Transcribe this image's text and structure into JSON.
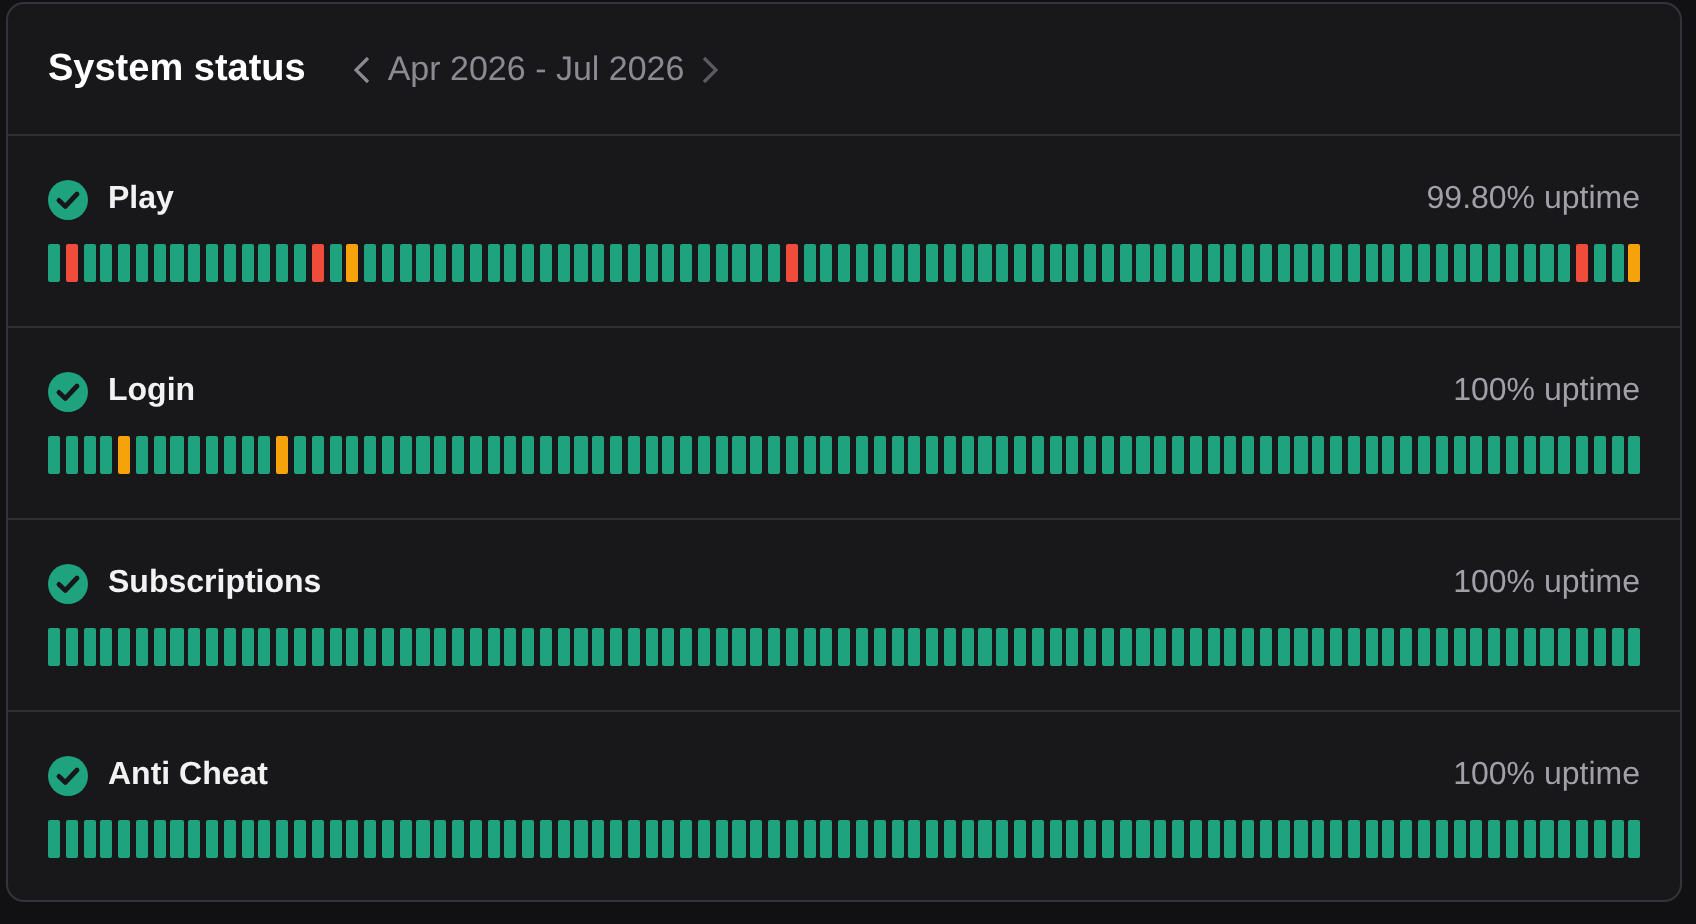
{
  "header": {
    "title": "System status",
    "date_range": "Apr 2026 - Jul 2026"
  },
  "services": [
    {
      "name": "Play",
      "uptime": "99.80% uptime",
      "bars": [
        {
          "color": "#1fa37f"
        },
        {
          "color": "#ef4c3c"
        },
        {
          "color": "#1fa37f"
        },
        {
          "color": "#1fa37f"
        },
        {
          "color": "#1fa37f"
        },
        {
          "color": "#1fa37f"
        },
        {
          "color": "#1fa37f"
        },
        {
          "color": "#1fa37f"
        },
        {
          "color": "#1fa37f"
        },
        {
          "color": "#1fa37f"
        },
        {
          "color": "#1fa37f"
        },
        {
          "color": "#1fa37f"
        },
        {
          "color": "#1fa37f"
        },
        {
          "color": "#1fa37f"
        },
        {
          "color": "#1fa37f"
        },
        {
          "color": "#ef4c3c"
        },
        {
          "color": "#1fa37f"
        },
        {
          "color": "#f5a20b"
        },
        {
          "color": "#1fa37f"
        },
        {
          "color": "#1fa37f"
        },
        {
          "color": "#1fa37f"
        },
        {
          "color": "#1fa37f"
        },
        {
          "color": "#1fa37f"
        },
        {
          "color": "#1fa37f"
        },
        {
          "color": "#1fa37f"
        },
        {
          "color": "#1fa37f"
        },
        {
          "color": "#1fa37f"
        },
        {
          "color": "#1fa37f"
        },
        {
          "color": "#1fa37f"
        },
        {
          "color": "#1fa37f"
        },
        {
          "color": "#1fa37f"
        },
        {
          "color": "#1fa37f"
        },
        {
          "color": "#1fa37f"
        },
        {
          "color": "#1fa37f"
        },
        {
          "color": "#1fa37f"
        },
        {
          "color": "#1fa37f"
        },
        {
          "color": "#1fa37f"
        },
        {
          "color": "#1fa37f"
        },
        {
          "color": "#1fa37f"
        },
        {
          "color": "#1fa37f"
        },
        {
          "color": "#1fa37f"
        },
        {
          "color": "#1fa37f"
        },
        {
          "color": "#ef4c3c"
        },
        {
          "color": "#1fa37f"
        },
        {
          "color": "#1fa37f"
        },
        {
          "color": "#1fa37f"
        },
        {
          "color": "#1fa37f"
        },
        {
          "color": "#1fa37f"
        },
        {
          "color": "#1fa37f"
        },
        {
          "color": "#1fa37f"
        },
        {
          "color": "#1fa37f"
        },
        {
          "color": "#1fa37f"
        },
        {
          "color": "#1fa37f"
        },
        {
          "color": "#1fa37f"
        },
        {
          "color": "#1fa37f"
        },
        {
          "color": "#1fa37f"
        },
        {
          "color": "#1fa37f"
        },
        {
          "color": "#1fa37f"
        },
        {
          "color": "#1fa37f"
        },
        {
          "color": "#1fa37f"
        },
        {
          "color": "#1fa37f"
        },
        {
          "color": "#1fa37f"
        },
        {
          "color": "#1fa37f"
        },
        {
          "color": "#1fa37f"
        },
        {
          "color": "#1fa37f"
        },
        {
          "color": "#1fa37f"
        },
        {
          "color": "#1fa37f"
        },
        {
          "color": "#1fa37f"
        },
        {
          "color": "#1fa37f"
        },
        {
          "color": "#1fa37f"
        },
        {
          "color": "#1fa37f"
        },
        {
          "color": "#1fa37f"
        },
        {
          "color": "#1fa37f"
        },
        {
          "color": "#1fa37f"
        },
        {
          "color": "#1fa37f"
        },
        {
          "color": "#1fa37f"
        },
        {
          "color": "#1fa37f"
        },
        {
          "color": "#1fa37f"
        },
        {
          "color": "#1fa37f"
        },
        {
          "color": "#1fa37f"
        },
        {
          "color": "#1fa37f"
        },
        {
          "color": "#1fa37f"
        },
        {
          "color": "#1fa37f"
        },
        {
          "color": "#1fa37f"
        },
        {
          "color": "#1fa37f"
        },
        {
          "color": "#1fa37f"
        },
        {
          "color": "#1fa37f"
        },
        {
          "color": "#ef4c3c"
        },
        {
          "color": "#1fa37f"
        },
        {
          "color": "#1fa37f"
        },
        {
          "color": "#f5a20b"
        }
      ]
    },
    {
      "name": "Login",
      "uptime": "100% uptime",
      "bars": [
        {
          "color": "#1fa37f"
        },
        {
          "color": "#1fa37f"
        },
        {
          "color": "#1fa37f"
        },
        {
          "color": "#1fa37f"
        },
        {
          "color": "#f5a20b"
        },
        {
          "color": "#1fa37f"
        },
        {
          "color": "#1fa37f"
        },
        {
          "color": "#1fa37f"
        },
        {
          "color": "#1fa37f"
        },
        {
          "color": "#1fa37f"
        },
        {
          "color": "#1fa37f"
        },
        {
          "color": "#1fa37f"
        },
        {
          "color": "#1fa37f"
        },
        {
          "color": "#f5a20b"
        },
        {
          "color": "#1fa37f"
        },
        {
          "color": "#1fa37f"
        },
        {
          "color": "#1fa37f"
        },
        {
          "color": "#1fa37f"
        },
        {
          "color": "#1fa37f"
        },
        {
          "color": "#1fa37f"
        },
        {
          "color": "#1fa37f"
        },
        {
          "color": "#1fa37f"
        },
        {
          "color": "#1fa37f"
        },
        {
          "color": "#1fa37f"
        },
        {
          "color": "#1fa37f"
        },
        {
          "color": "#1fa37f"
        },
        {
          "color": "#1fa37f"
        },
        {
          "color": "#1fa37f"
        },
        {
          "color": "#1fa37f"
        },
        {
          "color": "#1fa37f"
        },
        {
          "color": "#1fa37f"
        },
        {
          "color": "#1fa37f"
        },
        {
          "color": "#1fa37f"
        },
        {
          "color": "#1fa37f"
        },
        {
          "color": "#1fa37f"
        },
        {
          "color": "#1fa37f"
        },
        {
          "color": "#1fa37f"
        },
        {
          "color": "#1fa37f"
        },
        {
          "color": "#1fa37f"
        },
        {
          "color": "#1fa37f"
        },
        {
          "color": "#1fa37f"
        },
        {
          "color": "#1fa37f"
        },
        {
          "color": "#1fa37f"
        },
        {
          "color": "#1fa37f"
        },
        {
          "color": "#1fa37f"
        },
        {
          "color": "#1fa37f"
        },
        {
          "color": "#1fa37f"
        },
        {
          "color": "#1fa37f"
        },
        {
          "color": "#1fa37f"
        },
        {
          "color": "#1fa37f"
        },
        {
          "color": "#1fa37f"
        },
        {
          "color": "#1fa37f"
        },
        {
          "color": "#1fa37f"
        },
        {
          "color": "#1fa37f"
        },
        {
          "color": "#1fa37f"
        },
        {
          "color": "#1fa37f"
        },
        {
          "color": "#1fa37f"
        },
        {
          "color": "#1fa37f"
        },
        {
          "color": "#1fa37f"
        },
        {
          "color": "#1fa37f"
        },
        {
          "color": "#1fa37f"
        },
        {
          "color": "#1fa37f"
        },
        {
          "color": "#1fa37f"
        },
        {
          "color": "#1fa37f"
        },
        {
          "color": "#1fa37f"
        },
        {
          "color": "#1fa37f"
        },
        {
          "color": "#1fa37f"
        },
        {
          "color": "#1fa37f"
        },
        {
          "color": "#1fa37f"
        },
        {
          "color": "#1fa37f"
        },
        {
          "color": "#1fa37f"
        },
        {
          "color": "#1fa37f"
        },
        {
          "color": "#1fa37f"
        },
        {
          "color": "#1fa37f"
        },
        {
          "color": "#1fa37f"
        },
        {
          "color": "#1fa37f"
        },
        {
          "color": "#1fa37f"
        },
        {
          "color": "#1fa37f"
        },
        {
          "color": "#1fa37f"
        },
        {
          "color": "#1fa37f"
        },
        {
          "color": "#1fa37f"
        },
        {
          "color": "#1fa37f"
        },
        {
          "color": "#1fa37f"
        },
        {
          "color": "#1fa37f"
        },
        {
          "color": "#1fa37f"
        },
        {
          "color": "#1fa37f"
        },
        {
          "color": "#1fa37f"
        },
        {
          "color": "#1fa37f"
        },
        {
          "color": "#1fa37f"
        },
        {
          "color": "#1fa37f"
        },
        {
          "color": "#1fa37f"
        }
      ]
    },
    {
      "name": "Subscriptions",
      "uptime": "100% uptime",
      "bars": [
        {
          "color": "#1fa37f"
        },
        {
          "color": "#1fa37f"
        },
        {
          "color": "#1fa37f"
        },
        {
          "color": "#1fa37f"
        },
        {
          "color": "#1fa37f"
        },
        {
          "color": "#1fa37f"
        },
        {
          "color": "#1fa37f"
        },
        {
          "color": "#1fa37f"
        },
        {
          "color": "#1fa37f"
        },
        {
          "color": "#1fa37f"
        },
        {
          "color": "#1fa37f"
        },
        {
          "color": "#1fa37f"
        },
        {
          "color": "#1fa37f"
        },
        {
          "color": "#1fa37f"
        },
        {
          "color": "#1fa37f"
        },
        {
          "color": "#1fa37f"
        },
        {
          "color": "#1fa37f"
        },
        {
          "color": "#1fa37f"
        },
        {
          "color": "#1fa37f"
        },
        {
          "color": "#1fa37f"
        },
        {
          "color": "#1fa37f"
        },
        {
          "color": "#1fa37f"
        },
        {
          "color": "#1fa37f"
        },
        {
          "color": "#1fa37f"
        },
        {
          "color": "#1fa37f"
        },
        {
          "color": "#1fa37f"
        },
        {
          "color": "#1fa37f"
        },
        {
          "color": "#1fa37f"
        },
        {
          "color": "#1fa37f"
        },
        {
          "color": "#1fa37f"
        },
        {
          "color": "#1fa37f"
        },
        {
          "color": "#1fa37f"
        },
        {
          "color": "#1fa37f"
        },
        {
          "color": "#1fa37f"
        },
        {
          "color": "#1fa37f"
        },
        {
          "color": "#1fa37f"
        },
        {
          "color": "#1fa37f"
        },
        {
          "color": "#1fa37f"
        },
        {
          "color": "#1fa37f"
        },
        {
          "color": "#1fa37f"
        },
        {
          "color": "#1fa37f"
        },
        {
          "color": "#1fa37f"
        },
        {
          "color": "#1fa37f"
        },
        {
          "color": "#1fa37f"
        },
        {
          "color": "#1fa37f"
        },
        {
          "color": "#1fa37f"
        },
        {
          "color": "#1fa37f"
        },
        {
          "color": "#1fa37f"
        },
        {
          "color": "#1fa37f"
        },
        {
          "color": "#1fa37f"
        },
        {
          "color": "#1fa37f"
        },
        {
          "color": "#1fa37f"
        },
        {
          "color": "#1fa37f"
        },
        {
          "color": "#1fa37f"
        },
        {
          "color": "#1fa37f"
        },
        {
          "color": "#1fa37f"
        },
        {
          "color": "#1fa37f"
        },
        {
          "color": "#1fa37f"
        },
        {
          "color": "#1fa37f"
        },
        {
          "color": "#1fa37f"
        },
        {
          "color": "#1fa37f"
        },
        {
          "color": "#1fa37f"
        },
        {
          "color": "#1fa37f"
        },
        {
          "color": "#1fa37f"
        },
        {
          "color": "#1fa37f"
        },
        {
          "color": "#1fa37f"
        },
        {
          "color": "#1fa37f"
        },
        {
          "color": "#1fa37f"
        },
        {
          "color": "#1fa37f"
        },
        {
          "color": "#1fa37f"
        },
        {
          "color": "#1fa37f"
        },
        {
          "color": "#1fa37f"
        },
        {
          "color": "#1fa37f"
        },
        {
          "color": "#1fa37f"
        },
        {
          "color": "#1fa37f"
        },
        {
          "color": "#1fa37f"
        },
        {
          "color": "#1fa37f"
        },
        {
          "color": "#1fa37f"
        },
        {
          "color": "#1fa37f"
        },
        {
          "color": "#1fa37f"
        },
        {
          "color": "#1fa37f"
        },
        {
          "color": "#1fa37f"
        },
        {
          "color": "#1fa37f"
        },
        {
          "color": "#1fa37f"
        },
        {
          "color": "#1fa37f"
        },
        {
          "color": "#1fa37f"
        },
        {
          "color": "#1fa37f"
        },
        {
          "color": "#1fa37f"
        },
        {
          "color": "#1fa37f"
        },
        {
          "color": "#1fa37f"
        },
        {
          "color": "#1fa37f"
        }
      ]
    },
    {
      "name": "Anti Cheat",
      "uptime": "100% uptime",
      "bars": [
        {
          "color": "#1fa37f"
        },
        {
          "color": "#1fa37f"
        },
        {
          "color": "#1fa37f"
        },
        {
          "color": "#1fa37f"
        },
        {
          "color": "#1fa37f"
        },
        {
          "color": "#1fa37f"
        },
        {
          "color": "#1fa37f"
        },
        {
          "color": "#1fa37f"
        },
        {
          "color": "#1fa37f"
        },
        {
          "color": "#1fa37f"
        },
        {
          "color": "#1fa37f"
        },
        {
          "color": "#1fa37f"
        },
        {
          "color": "#1fa37f"
        },
        {
          "color": "#1fa37f"
        },
        {
          "color": "#1fa37f"
        },
        {
          "color": "#1fa37f"
        },
        {
          "color": "#1fa37f"
        },
        {
          "color": "#1fa37f"
        },
        {
          "color": "#1fa37f"
        },
        {
          "color": "#1fa37f"
        },
        {
          "color": "#1fa37f"
        },
        {
          "color": "#1fa37f"
        },
        {
          "color": "#1fa37f"
        },
        {
          "color": "#1fa37f"
        },
        {
          "color": "#1fa37f"
        },
        {
          "color": "#1fa37f"
        },
        {
          "color": "#1fa37f"
        },
        {
          "color": "#1fa37f"
        },
        {
          "color": "#1fa37f"
        },
        {
          "color": "#1fa37f"
        },
        {
          "color": "#1fa37f"
        },
        {
          "color": "#1fa37f"
        },
        {
          "color": "#1fa37f"
        },
        {
          "color": "#1fa37f"
        },
        {
          "color": "#1fa37f"
        },
        {
          "color": "#1fa37f"
        },
        {
          "color": "#1fa37f"
        },
        {
          "color": "#1fa37f"
        },
        {
          "color": "#1fa37f"
        },
        {
          "color": "#1fa37f"
        },
        {
          "color": "#1fa37f"
        },
        {
          "color": "#1fa37f"
        },
        {
          "color": "#1fa37f"
        },
        {
          "color": "#1fa37f"
        },
        {
          "color": "#1fa37f"
        },
        {
          "color": "#1fa37f"
        },
        {
          "color": "#1fa37f"
        },
        {
          "color": "#1fa37f"
        },
        {
          "color": "#1fa37f"
        },
        {
          "color": "#1fa37f"
        },
        {
          "color": "#1fa37f"
        },
        {
          "color": "#1fa37f"
        },
        {
          "color": "#1fa37f"
        },
        {
          "color": "#1fa37f"
        },
        {
          "color": "#1fa37f"
        },
        {
          "color": "#1fa37f"
        },
        {
          "color": "#1fa37f"
        },
        {
          "color": "#1fa37f"
        },
        {
          "color": "#1fa37f"
        },
        {
          "color": "#1fa37f"
        },
        {
          "color": "#1fa37f"
        },
        {
          "color": "#1fa37f"
        },
        {
          "color": "#1fa37f"
        },
        {
          "color": "#1fa37f"
        },
        {
          "color": "#1fa37f"
        },
        {
          "color": "#1fa37f"
        },
        {
          "color": "#1fa37f"
        },
        {
          "color": "#1fa37f"
        },
        {
          "color": "#1fa37f"
        },
        {
          "color": "#1fa37f"
        },
        {
          "color": "#1fa37f"
        },
        {
          "color": "#1fa37f"
        },
        {
          "color": "#1fa37f"
        },
        {
          "color": "#1fa37f"
        },
        {
          "color": "#1fa37f"
        },
        {
          "color": "#1fa37f"
        },
        {
          "color": "#1fa37f"
        },
        {
          "color": "#1fa37f"
        },
        {
          "color": "#1fa37f"
        },
        {
          "color": "#1fa37f"
        },
        {
          "color": "#1fa37f"
        },
        {
          "color": "#1fa37f"
        },
        {
          "color": "#1fa37f"
        },
        {
          "color": "#1fa37f"
        },
        {
          "color": "#1fa37f"
        },
        {
          "color": "#1fa37f"
        },
        {
          "color": "#1fa37f"
        },
        {
          "color": "#1fa37f"
        },
        {
          "color": "#1fa37f"
        },
        {
          "color": "#1fa37f"
        },
        {
          "color": "#1fa37f"
        }
      ]
    }
  ]
}
